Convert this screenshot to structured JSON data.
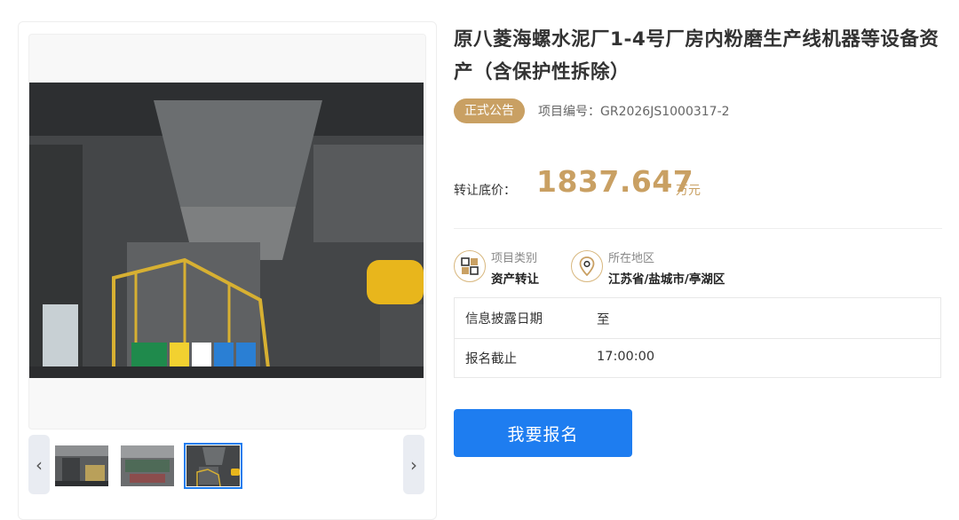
{
  "listing": {
    "title": "原八菱海螺水泥厂1-4号厂房内粉磨生产线机器等设备资产（含保护性拆除）",
    "status_badge": "正式公告",
    "project_no": "项目编号：GR2026JS1000317-2"
  },
  "price": {
    "label": "转让底价：",
    "value": "1837.647",
    "unit": "万元"
  },
  "info": {
    "category_title": "项目类别",
    "category_value": "资产转让",
    "location_title": "所在地区",
    "location_value": "江苏省/盐城市/亭湖区"
  },
  "table": {
    "rows": [
      {
        "label": "信息披露日期",
        "value": "至"
      },
      {
        "label": "报名截止",
        "value": "17:00:00"
      }
    ]
  },
  "actions": {
    "signup_label": "我要报名"
  },
  "gallery": {
    "prev_label": "‹",
    "next_label": "›",
    "active_thumb": 3,
    "thumb_count": 3
  },
  "icons": {
    "category": "grid-icon",
    "location": "map-pin-icon"
  },
  "colors": {
    "gold": "#c9a063",
    "primary_blue": "#1e7df0"
  }
}
